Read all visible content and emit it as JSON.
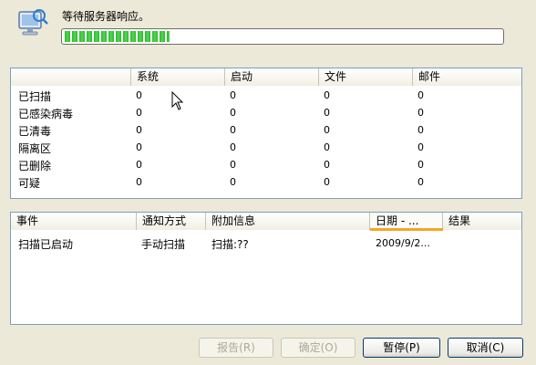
{
  "header": {
    "status_text": "等待服务器响应。",
    "progress": 0.24
  },
  "stats": {
    "columns": [
      "系统",
      "启动",
      "文件",
      "邮件"
    ],
    "rows": [
      {
        "label": "已扫描",
        "values": [
          "0",
          "0",
          "0",
          "0"
        ]
      },
      {
        "label": "已感染病毒",
        "values": [
          "0",
          "0",
          "0",
          "0"
        ]
      },
      {
        "label": "已清毒",
        "values": [
          "0",
          "0",
          "0",
          "0"
        ]
      },
      {
        "label": "隔离区",
        "values": [
          "0",
          "0",
          "0",
          "0"
        ]
      },
      {
        "label": "已删除",
        "values": [
          "0",
          "0",
          "0",
          "0"
        ]
      },
      {
        "label": "可疑",
        "values": [
          "0",
          "0",
          "0",
          "0"
        ]
      }
    ]
  },
  "events": {
    "columns": [
      "事件",
      "通知方式",
      "附加信息",
      "日期 - ...",
      "结果"
    ],
    "rows": [
      {
        "event": "扫描已启动",
        "method": "手动扫描",
        "info": "扫描:??",
        "date": "2009/9/2...",
        "result": ""
      }
    ]
  },
  "buttons": {
    "report": "报告(R)",
    "ok": "确定(O)",
    "pause": "暂停(P)",
    "cancel": "取消(C)"
  }
}
